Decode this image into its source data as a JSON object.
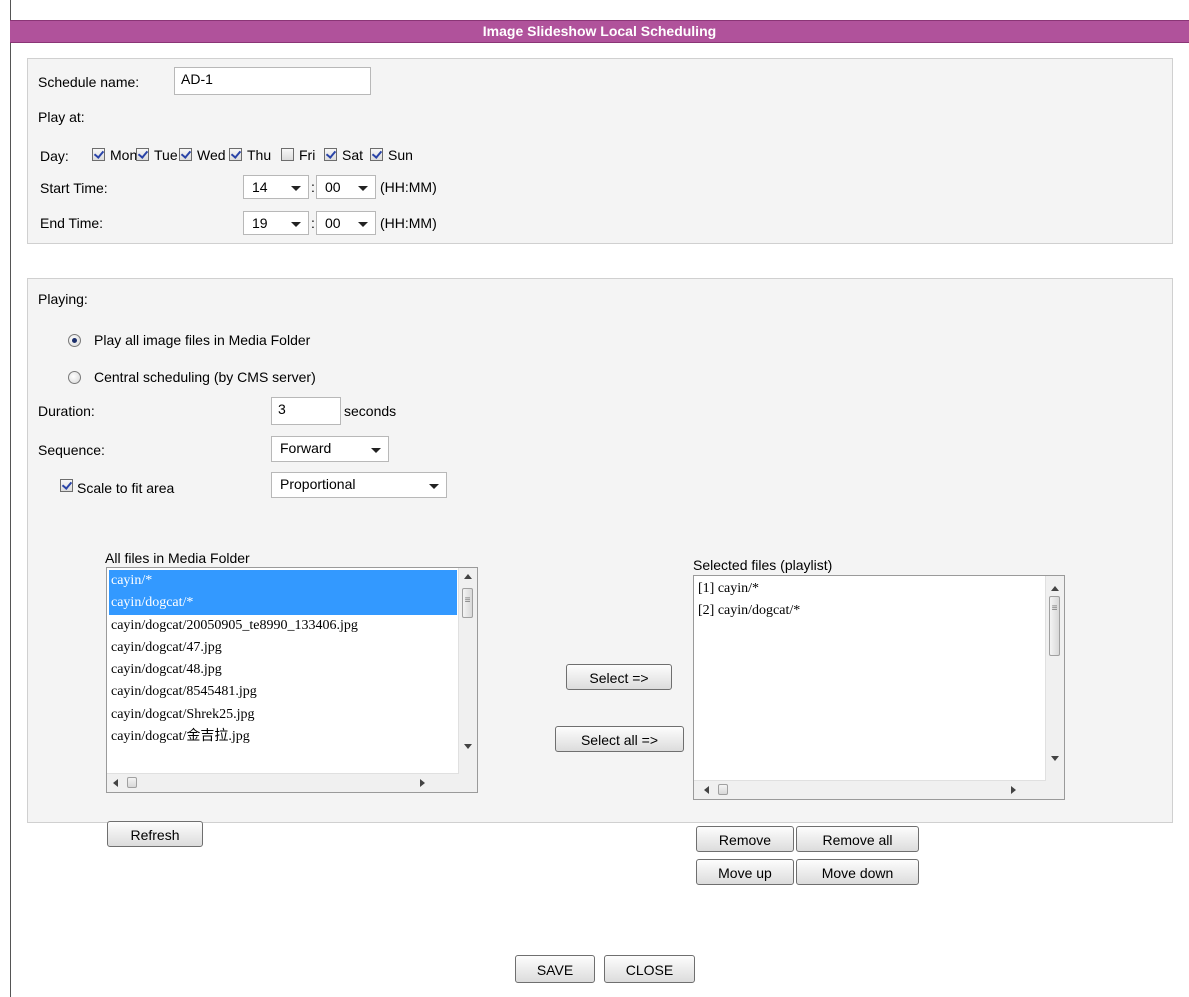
{
  "window": {
    "title": "Image Slideshow Local Scheduling"
  },
  "schedule": {
    "name_label": "Schedule name:",
    "name_value": "AD-1",
    "play_at_label": "Play at:",
    "day_label": "Day:",
    "days": [
      {
        "label": "Mon",
        "checked": true
      },
      {
        "label": "Tue",
        "checked": true
      },
      {
        "label": "Wed",
        "checked": true
      },
      {
        "label": "Thu",
        "checked": true
      },
      {
        "label": "Fri",
        "checked": false
      },
      {
        "label": "Sat",
        "checked": true
      },
      {
        "label": "Sun",
        "checked": true
      }
    ],
    "start_label": "Start Time:",
    "start_hour": "14",
    "start_min": "00",
    "end_label": "End Time:",
    "end_hour": "19",
    "end_min": "00",
    "colon": ":",
    "format": "(HH:MM)"
  },
  "playing": {
    "label": "Playing:",
    "option_all": "Play all image files in Media Folder",
    "option_central": "Central scheduling (by CMS server)",
    "selected_option": "all",
    "duration_label": "Duration:",
    "duration_value": "3",
    "duration_unit": "seconds",
    "sequence_label": "Sequence:",
    "sequence_value": "Forward",
    "scale_label": "Scale to fit area",
    "scale_checked": true,
    "scale_value": "Proportional"
  },
  "media": {
    "label": "All files in Media Folder",
    "files": [
      {
        "name": "cayin/*",
        "selected": true
      },
      {
        "name": "cayin/dogcat/*",
        "selected": true
      },
      {
        "name": "cayin/dogcat/20050905_te8990_133406.jpg",
        "selected": false
      },
      {
        "name": "cayin/dogcat/47.jpg",
        "selected": false
      },
      {
        "name": "cayin/dogcat/48.jpg",
        "selected": false
      },
      {
        "name": "cayin/dogcat/8545481.jpg",
        "selected": false
      },
      {
        "name": "cayin/dogcat/Shrek25.jpg",
        "selected": false
      },
      {
        "name": "cayin/dogcat/金吉拉.jpg",
        "selected": false
      }
    ],
    "refresh_label": "Refresh"
  },
  "transfer": {
    "select_label": "Select =>",
    "select_all_label": "Select all =>"
  },
  "playlist": {
    "label": "Selected files (playlist)",
    "items": [
      "[1] cayin/*",
      "[2] cayin/dogcat/*"
    ],
    "remove_label": "Remove",
    "remove_all_label": "Remove all",
    "move_up_label": "Move up",
    "move_down_label": "Move down"
  },
  "footer": {
    "save_label": "SAVE",
    "close_label": "CLOSE"
  }
}
